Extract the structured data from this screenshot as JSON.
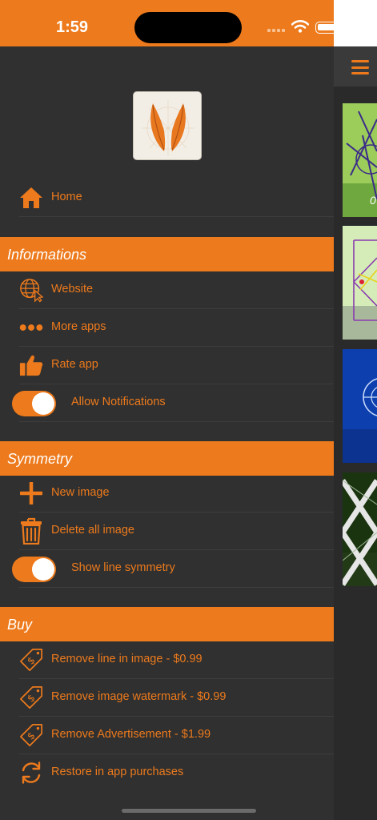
{
  "status_bar": {
    "time": "1:59"
  },
  "drawer": {
    "home": {
      "label": "Home",
      "icon": "home-icon"
    },
    "sections": {
      "informations": {
        "title": "Informations",
        "items": [
          {
            "label": "Website",
            "icon": "globe-cursor-icon"
          },
          {
            "label": "More apps",
            "icon": "more-dots-icon"
          },
          {
            "label": "Rate app",
            "icon": "thumbs-up-icon"
          }
        ],
        "toggle": {
          "label": "Allow Notifications",
          "on": true
        }
      },
      "symmetry": {
        "title": "Symmetry",
        "items": [
          {
            "label": "New image",
            "icon": "plus-icon"
          },
          {
            "label": "Delete all image",
            "icon": "trash-icon"
          }
        ],
        "toggle": {
          "label": "Show line symmetry",
          "on": true
        }
      },
      "buy": {
        "title": "Buy",
        "items": [
          {
            "label": "Remove line in image - $0.99",
            "icon": "price-tag-icon"
          },
          {
            "label": "Remove image watermark - $0.99",
            "icon": "price-tag-icon"
          },
          {
            "label": "Remove Advertisement - $1.99",
            "icon": "price-tag-icon"
          },
          {
            "label": "Restore in app purchases",
            "icon": "restore-icon"
          }
        ]
      }
    }
  },
  "colors": {
    "accent": "#ed7a1c",
    "drawer_bg": "#303030",
    "text_on_accent": "#ffffff"
  }
}
